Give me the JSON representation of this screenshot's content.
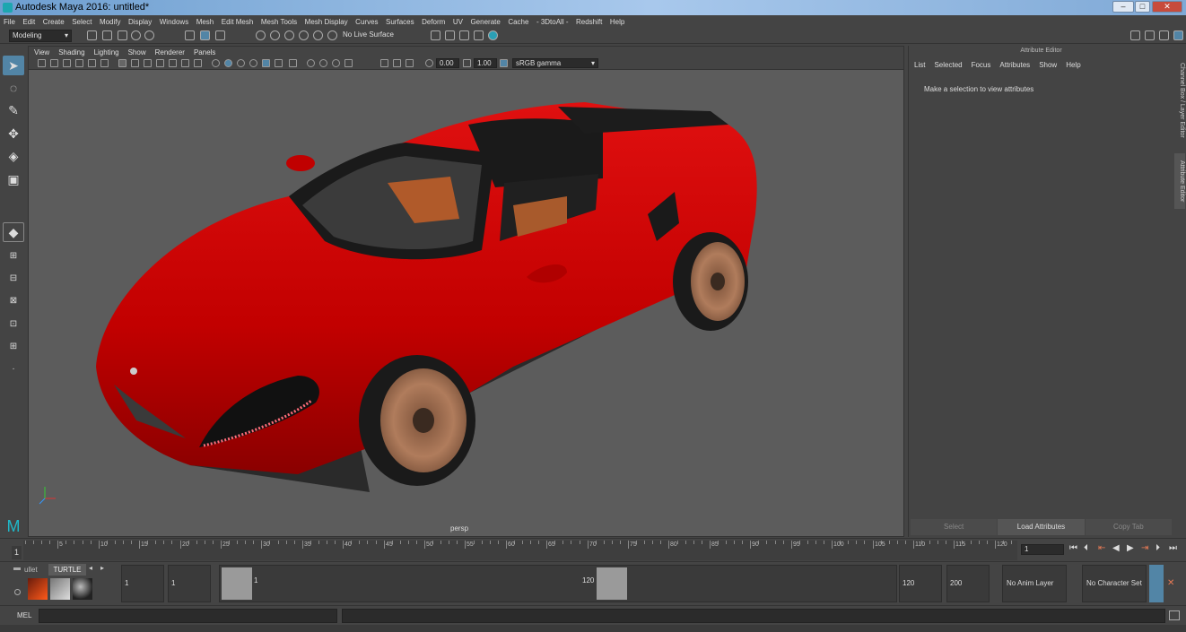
{
  "window": {
    "title": "Autodesk Maya 2016: untitled*"
  },
  "menubar": [
    "File",
    "Edit",
    "Create",
    "Select",
    "Modify",
    "Display",
    "Windows",
    "Mesh",
    "Edit Mesh",
    "Mesh Tools",
    "Mesh Display",
    "Curves",
    "Surfaces",
    "Deform",
    "UV",
    "Generate",
    "Cache",
    "- 3DtoAll -",
    "Redshift",
    "Help"
  ],
  "shelf": {
    "mode": "Modeling",
    "live_surface": "No Live Surface"
  },
  "viewport": {
    "menu": [
      "View",
      "Shading",
      "Lighting",
      "Show",
      "Renderer",
      "Panels"
    ],
    "exposure": "0.00",
    "gamma": "1.00",
    "colorspace": "sRGB gamma",
    "camera_label": "persp"
  },
  "attribute_editor": {
    "title": "Attribute Editor",
    "menu": [
      "List",
      "Selected",
      "Focus",
      "Attributes",
      "Show",
      "Help"
    ],
    "message": "Make a selection to view attributes",
    "buttons": [
      "Select",
      "Load Attributes",
      "Copy Tab"
    ]
  },
  "side_tabs": [
    "Channel Box / Layer Editor",
    "Attribute Editor"
  ],
  "timeline": {
    "ticks": [
      "5",
      "10",
      "15",
      "20",
      "25",
      "30",
      "35",
      "40",
      "45",
      "50",
      "55",
      "60",
      "65",
      "70",
      "75",
      "80",
      "85",
      "90",
      "95",
      "100",
      "105",
      "110",
      "115",
      "120"
    ],
    "current_frame": "1",
    "frame_field": "1"
  },
  "range": {
    "shelf_tabs": [
      "ullet",
      "TURTLE"
    ],
    "start": "1",
    "inner_start": "1",
    "slider_start": "1",
    "slider_end": "120",
    "end": "120",
    "max_end": "200",
    "anim_layer": "No Anim Layer",
    "char_set": "No Character Set"
  },
  "command_line": {
    "label": "MEL"
  },
  "colors": {
    "car_body": "#cc0000",
    "wheel": "#a57252",
    "accent": "#5285a6"
  }
}
